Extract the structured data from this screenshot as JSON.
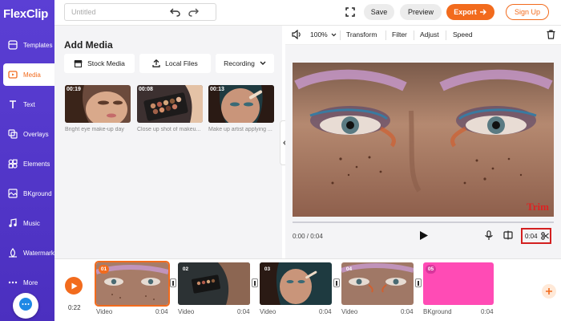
{
  "brand": {
    "logo_text": "FlexClip",
    "accent": "#f26b1d",
    "sidebar_color": "#5b3fd4"
  },
  "sidebar": {
    "items": [
      {
        "label": "Templates",
        "icon": "templates-icon"
      },
      {
        "label": "Media",
        "icon": "media-icon",
        "active": true
      },
      {
        "label": "Text",
        "icon": "text-icon"
      },
      {
        "label": "Overlays",
        "icon": "overlays-icon"
      },
      {
        "label": "Elements",
        "icon": "elements-icon"
      },
      {
        "label": "BKground",
        "icon": "background-icon"
      },
      {
        "label": "Music",
        "icon": "music-icon"
      },
      {
        "label": "Watermark",
        "icon": "watermark-icon"
      },
      {
        "label": "More",
        "icon": "more-icon"
      }
    ],
    "chat_icon": "chat-icon"
  },
  "topbar": {
    "title_placeholder": "Untitled",
    "save_label": "Save",
    "preview_label": "Preview",
    "export_label": "Export",
    "signup_label": "Sign Up"
  },
  "media": {
    "title": "Add Media",
    "tabs": {
      "stock": "Stock Media",
      "local": "Local Files",
      "recording": "Recording"
    },
    "items": [
      {
        "duration": "00:19",
        "caption": "Bright eye make-up day"
      },
      {
        "duration": "00:08",
        "caption": "Close up shot of makeu..."
      },
      {
        "duration": "00:13",
        "caption": "Make up artist applying ..."
      }
    ]
  },
  "preview": {
    "toolbar": {
      "zoom": "100%",
      "transform": "Transform",
      "filter": "Filter",
      "adjust": "Adjust",
      "speed": "Speed"
    },
    "watermark": "Trim",
    "time": "0:00 / 0:04",
    "duration": "0:04"
  },
  "timeline": {
    "current_time": "0:22",
    "clips": [
      {
        "num": "01",
        "label": "Video",
        "duration": "0:04"
      },
      {
        "num": "02",
        "label": "Video",
        "duration": "0:04"
      },
      {
        "num": "03",
        "label": "Video",
        "duration": "0:04"
      },
      {
        "num": "04",
        "label": "Video",
        "duration": "0:04"
      },
      {
        "num": "05",
        "label": "BKground",
        "duration": "0:04"
      }
    ]
  }
}
